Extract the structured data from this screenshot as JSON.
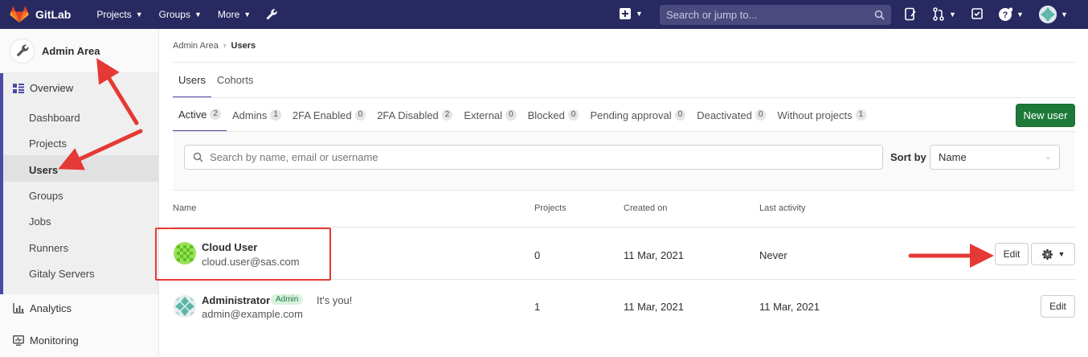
{
  "topbar": {
    "app_name": "GitLab",
    "nav": [
      "Projects",
      "Groups",
      "More"
    ],
    "search_placeholder": "Search or jump to...",
    "colors": {
      "navbar": "#292961"
    }
  },
  "sidebar": {
    "title": "Admin Area",
    "overview_label": "Overview",
    "items": [
      "Dashboard",
      "Projects",
      "Users",
      "Groups",
      "Jobs",
      "Runners",
      "Gitaly Servers"
    ],
    "active_item": "Users",
    "analytics_label": "Analytics",
    "monitoring_label": "Monitoring"
  },
  "breadcrumb": {
    "parent": "Admin Area",
    "current": "Users"
  },
  "tabs": [
    "Users",
    "Cohorts"
  ],
  "filter_tabs": [
    {
      "label": "Active",
      "count": "2"
    },
    {
      "label": "Admins",
      "count": "1"
    },
    {
      "label": "2FA Enabled",
      "count": "0"
    },
    {
      "label": "2FA Disabled",
      "count": "2"
    },
    {
      "label": "External",
      "count": "0"
    },
    {
      "label": "Blocked",
      "count": "0"
    },
    {
      "label": "Pending approval",
      "count": "0"
    },
    {
      "label": "Deactivated",
      "count": "0"
    },
    {
      "label": "Without projects",
      "count": "1"
    }
  ],
  "new_user_label": "New user",
  "search": {
    "placeholder": "Search by name, email or username"
  },
  "sort": {
    "label": "Sort by",
    "value": "Name"
  },
  "table": {
    "headers": [
      "Name",
      "Projects",
      "Created on",
      "Last activity"
    ],
    "rows": [
      {
        "name": "Cloud User",
        "email": "cloud.user@sas.com",
        "projects": "0",
        "created": "11 Mar, 2021",
        "last_activity": "Never",
        "edit": "Edit"
      },
      {
        "name": "Administrator",
        "badge": "Admin",
        "note": "It's you!",
        "email": "admin@example.com",
        "projects": "1",
        "created": "11 Mar, 2021",
        "last_activity": "11 Mar, 2021",
        "edit": "Edit"
      }
    ]
  },
  "annotation_color": "#e53935"
}
